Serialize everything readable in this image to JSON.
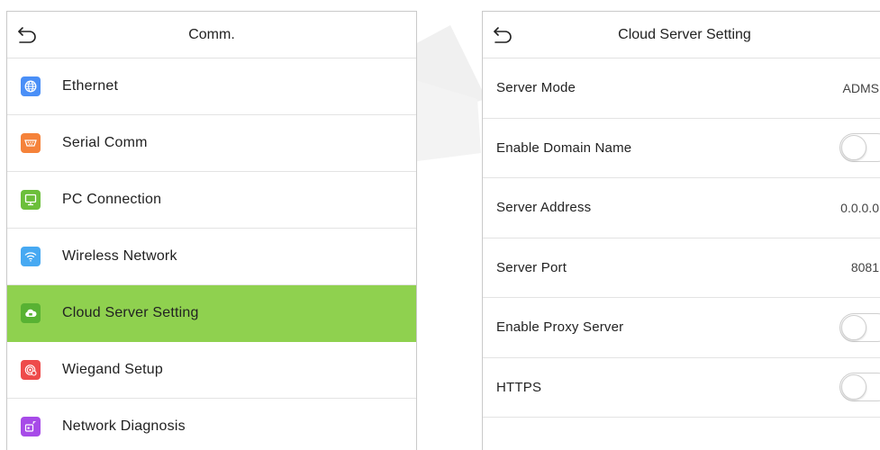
{
  "left_screen": {
    "title": "Comm.",
    "back_icon": "back-arrow-icon",
    "selected_index": 4,
    "highlight_color": "#8fd14f",
    "items": [
      {
        "label": "Ethernet",
        "icon": "globe-icon",
        "icon_color": "#4a8ff7"
      },
      {
        "label": "Serial Comm",
        "icon": "serial-port-icon",
        "icon_color": "#f5823a"
      },
      {
        "label": "PC Connection",
        "icon": "monitor-icon",
        "icon_color": "#6cbf3b"
      },
      {
        "label": "Wireless Network",
        "icon": "wifi-icon",
        "icon_color": "#47a9f2"
      },
      {
        "label": "Cloud Server Setting",
        "icon": "cloud-icon",
        "icon_color": "#58b233"
      },
      {
        "label": "Wiegand Setup",
        "icon": "wiegand-icon",
        "icon_color": "#ee4b4b"
      },
      {
        "label": "Network Diagnosis",
        "icon": "network-diagnosis-icon",
        "icon_color": "#a74be8"
      }
    ]
  },
  "right_screen": {
    "title": "Cloud Server Setting",
    "back_icon": "back-arrow-icon",
    "rows": [
      {
        "label": "Server Mode",
        "value": "ADMS"
      },
      {
        "label": "Enable Domain Name",
        "toggle": false
      },
      {
        "label": "Server Address",
        "value": "0.0.0.0"
      },
      {
        "label": "Server Port",
        "value": "8081"
      },
      {
        "label": "Enable Proxy Server",
        "toggle": false
      },
      {
        "label": "HTTPS",
        "toggle": false
      }
    ]
  }
}
